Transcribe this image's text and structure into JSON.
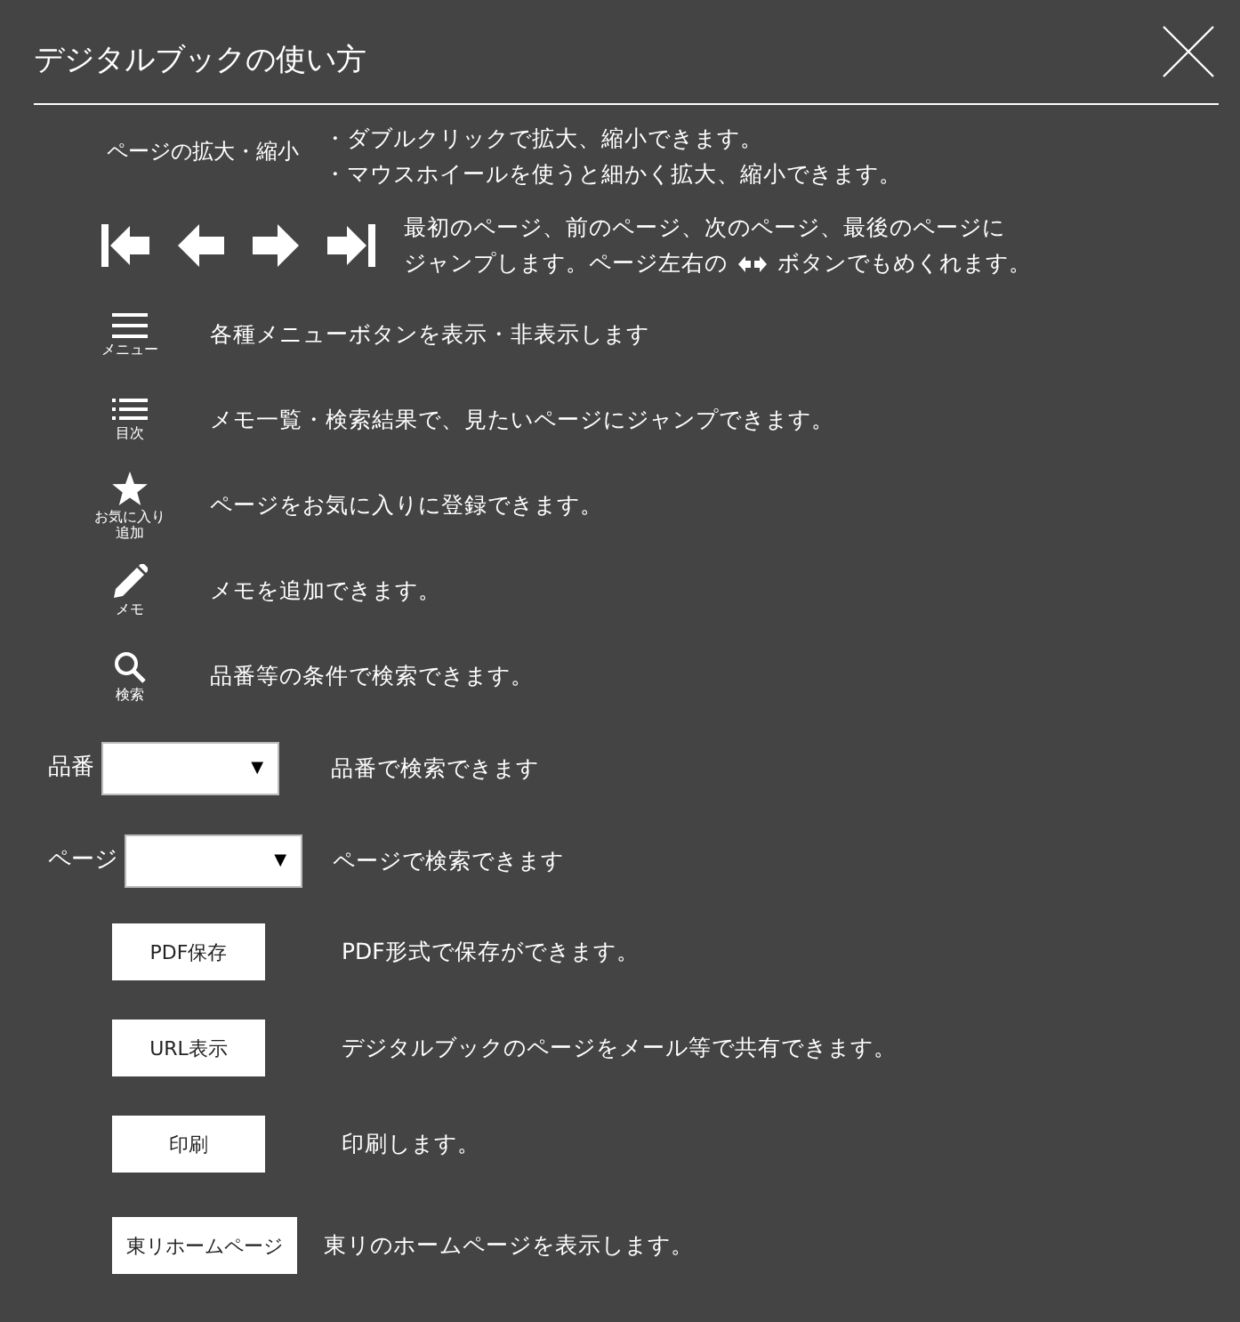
{
  "title": "デジタルブックの使い方",
  "zoom": {
    "label": "ページの拡大・縮小",
    "lines": [
      "・ダブルクリックで拡大、縮小できます。",
      "・マウスホイールを使うと細かく拡大、縮小できます。"
    ]
  },
  "navigation": {
    "icons": [
      {
        "kind": "first"
      },
      {
        "kind": "prev"
      },
      {
        "kind": "next"
      },
      {
        "kind": "last"
      }
    ],
    "line_1": "最初のページ、前のページ、次のページ、最後のページに",
    "line_2_before": "ジャンプします。ページ左右の",
    "line_2_after": "ボタンでもめくれます。"
  },
  "icon_rows": [
    {
      "kind": "menu",
      "caption": "メニュー",
      "text": "各種メニューボタンを表示・非表示します"
    },
    {
      "kind": "list",
      "caption": "目次",
      "text": "メモ一覧・検索結果で、見たいページにジャンプできます。"
    },
    {
      "kind": "star",
      "caption": "お気に入り追加",
      "text": "ページをお気に入りに登録できます。"
    },
    {
      "kind": "pencil",
      "caption": "メモ",
      "text": "メモを追加できます。"
    },
    {
      "kind": "search",
      "caption": "検索",
      "text": "品番等の条件で検索できます。"
    }
  ],
  "selects": [
    {
      "label": "品番",
      "arrow": "▼",
      "text": "品番で検索できます"
    },
    {
      "label": "ページ",
      "arrow": "▼",
      "text": "ページで検索できます"
    }
  ],
  "buttons": [
    {
      "label": "PDF保存",
      "text": "PDF形式で保存ができます。"
    },
    {
      "label": "URL表示",
      "text": "デジタルブックのページをメール等で共有できます。"
    },
    {
      "label": "印刷",
      "text": "印刷します。"
    },
    {
      "label": "東リホームページ",
      "text": "東リのホームページを表示します。"
    }
  ]
}
